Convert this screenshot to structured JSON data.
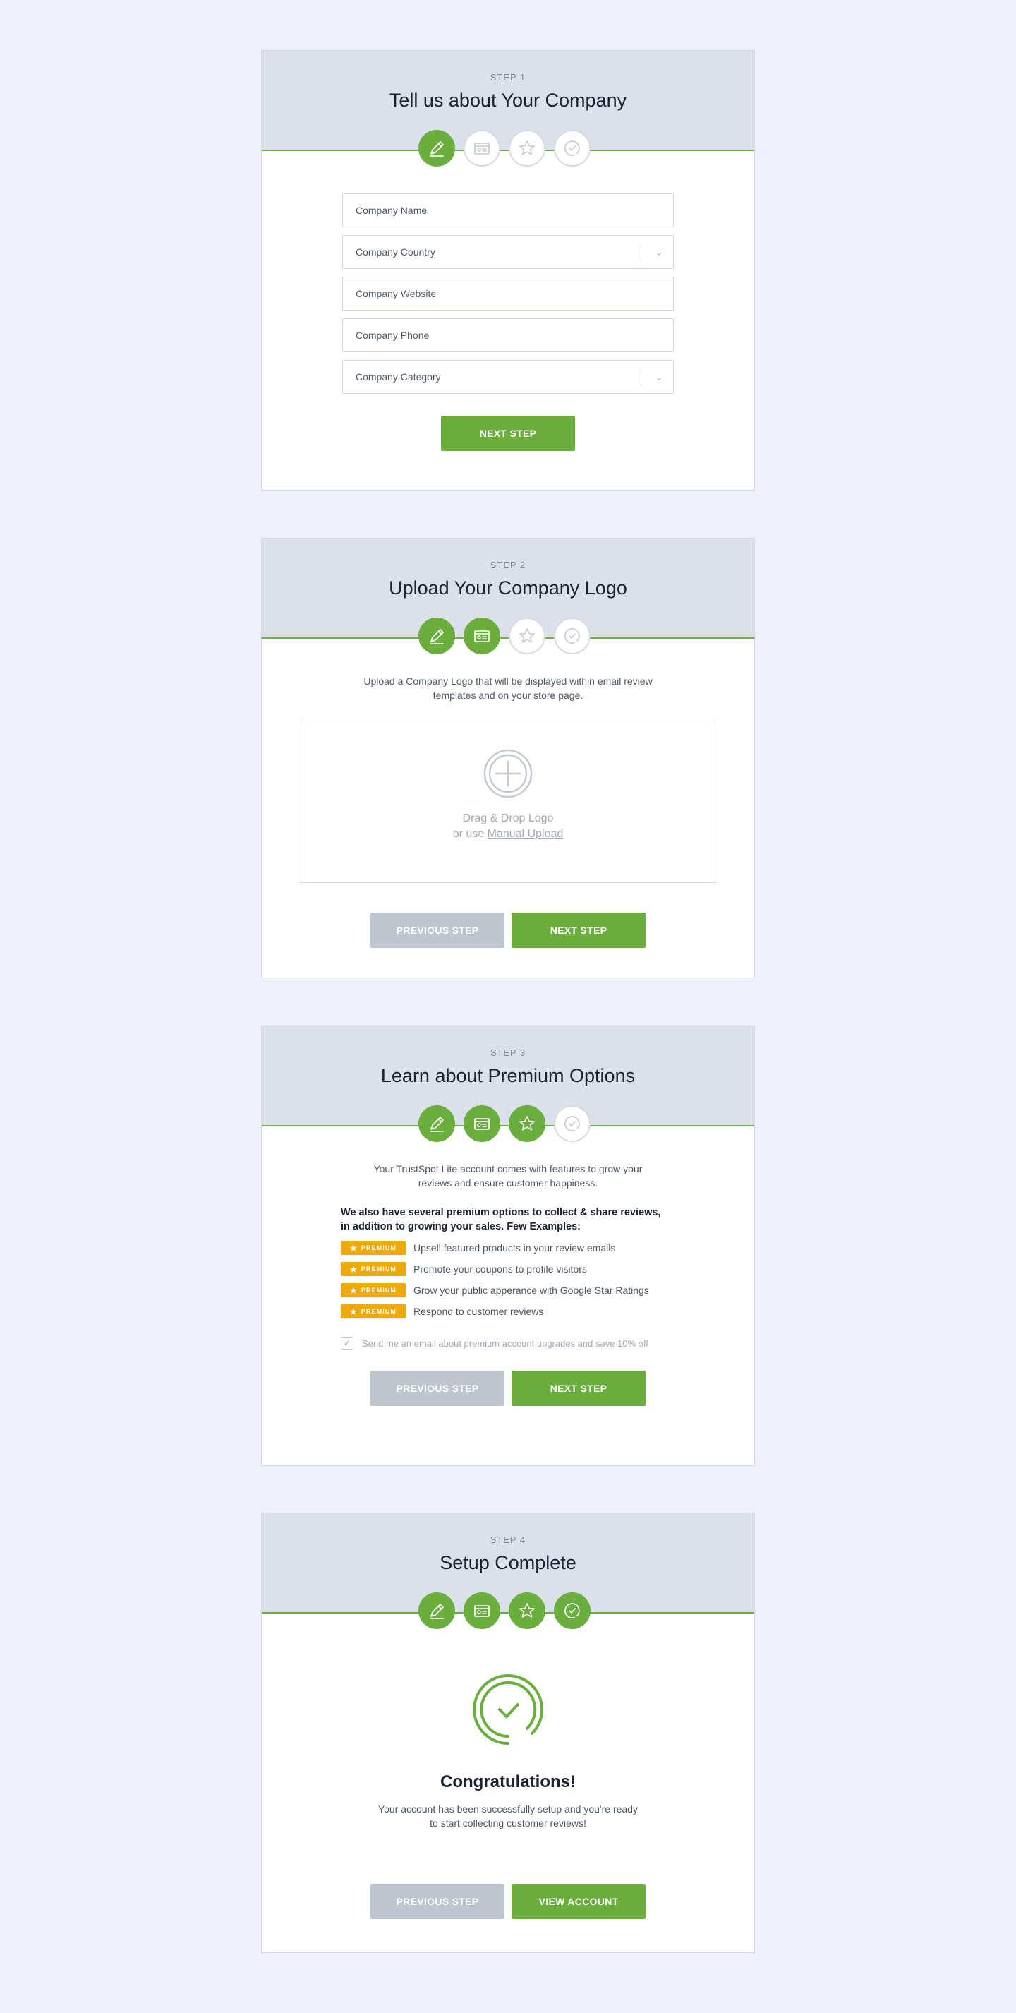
{
  "cards": [
    {
      "step_label": "STEP 1",
      "title": "Tell us about Your Company",
      "fields": {
        "company_name": "Company Name",
        "company_country": "Company Country",
        "company_website": "Company Website",
        "company_phone": "Company Phone",
        "company_category": "Company Category"
      },
      "next_label": "NEXT STEP"
    },
    {
      "step_label": "STEP 2",
      "title": "Upload Your Company Logo",
      "intro_line1": "Upload a Company Logo that will be displayed within email review",
      "intro_line2": "templates and on your store page.",
      "drop_line1": "Drag & Drop Logo",
      "drop_prefix": "or use",
      "drop_link": "Manual Upload",
      "prev_label": "PREVIOUS STEP",
      "next_label": "NEXT STEP"
    },
    {
      "step_label": "STEP 3",
      "title": "Learn about Premium Options",
      "intro_line1": "Your TrustSpot Lite account comes with features to grow your",
      "intro_line2": "reviews and ensure customer happiness.",
      "premium_head_line1": "We also have several premium options to collect & share reviews,",
      "premium_head_line2": "in addition to growing your sales. Few Examples:",
      "badge_label": "PREMIUM",
      "premium_items": [
        "Upsell featured products in your review emails",
        "Promote your coupons to profile visitors",
        "Grow your public apperance with Google Star Ratings",
        "Respond to customer reviews"
      ],
      "email_opt_in": "Send me an email about premium account upgrades and save 10% off",
      "email_opt_in_checked": true,
      "prev_label": "PREVIOUS STEP",
      "next_label": "NEXT STEP"
    },
    {
      "step_label": "STEP 4",
      "title": "Setup Complete",
      "congrats": "Congratulations!",
      "message_line1": "Your account has been successfully setup and you're ready",
      "message_line2": "to start collecting customer reviews!",
      "prev_label": "PREVIOUS STEP",
      "view_label": "VIEW ACCOUNT"
    }
  ],
  "step_icons": [
    "pencil-icon",
    "id-card-icon",
    "star-icon",
    "clock-check-icon"
  ],
  "colors": {
    "accent_green": "#6aae3d",
    "premium_badge": "#eeaa0d",
    "header_bg": "#dce1e9",
    "page_bg": "#eef1f9",
    "button_gray": "#bfc6d0"
  }
}
